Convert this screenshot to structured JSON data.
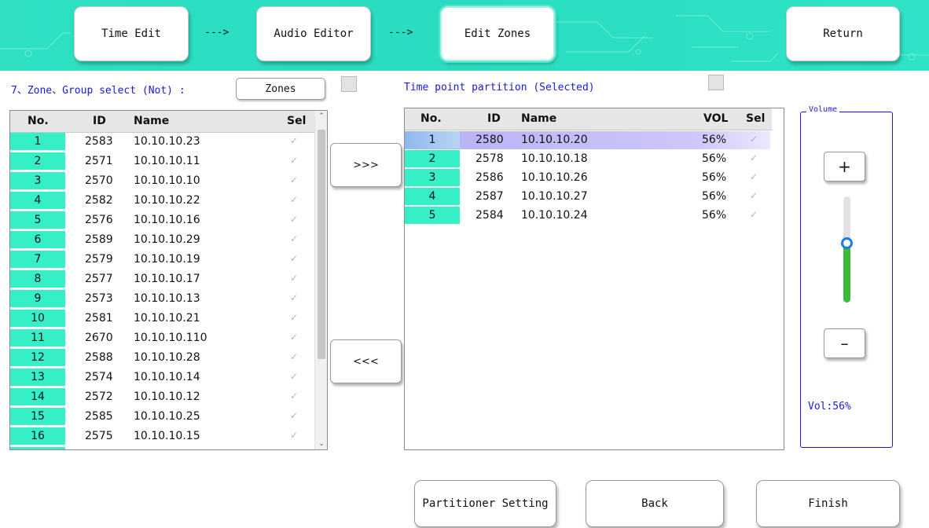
{
  "nav": {
    "steps": [
      {
        "label": "Time Edit"
      },
      {
        "label": "Audio Editor"
      },
      {
        "label": "Edit Zones"
      }
    ],
    "arrow": "--->",
    "return_label": "Return"
  },
  "zone_select": {
    "title": "7、Zone、Group select (Not) :",
    "zones_button": "Zones",
    "headers": {
      "no": "No.",
      "id": "ID",
      "name": "Name",
      "sel": "Sel"
    },
    "rows": [
      {
        "no": "1",
        "id": "2583",
        "name": "10.10.10.23"
      },
      {
        "no": "2",
        "id": "2571",
        "name": "10.10.10.11"
      },
      {
        "no": "3",
        "id": "2570",
        "name": "10.10.10.10"
      },
      {
        "no": "4",
        "id": "2582",
        "name": "10.10.10.22"
      },
      {
        "no": "5",
        "id": "2576",
        "name": "10.10.10.16"
      },
      {
        "no": "6",
        "id": "2589",
        "name": "10.10.10.29"
      },
      {
        "no": "7",
        "id": "2579",
        "name": "10.10.10.19"
      },
      {
        "no": "8",
        "id": "2577",
        "name": "10.10.10.17"
      },
      {
        "no": "9",
        "id": "2573",
        "name": "10.10.10.13"
      },
      {
        "no": "10",
        "id": "2581",
        "name": "10.10.10.21"
      },
      {
        "no": "11",
        "id": "2670",
        "name": "10.10.10.110"
      },
      {
        "no": "12",
        "id": "2588",
        "name": "10.10.10.28"
      },
      {
        "no": "13",
        "id": "2574",
        "name": "10.10.10.14"
      },
      {
        "no": "14",
        "id": "2572",
        "name": "10.10.10.12"
      },
      {
        "no": "15",
        "id": "2585",
        "name": "10.10.10.25"
      },
      {
        "no": "16",
        "id": "2575",
        "name": "10.10.10.15"
      }
    ]
  },
  "move": {
    "add_label": ">>>",
    "remove_label": "<<<"
  },
  "selected_zones": {
    "title": "Time point partition (Selected)",
    "headers": {
      "no": "No.",
      "id": "ID",
      "name": "Name",
      "vol": "VOL",
      "sel": "Sel"
    },
    "rows": [
      {
        "no": "1",
        "id": "2580",
        "name": "10.10.10.20",
        "vol": "56%",
        "highlighted": true
      },
      {
        "no": "2",
        "id": "2578",
        "name": "10.10.10.18",
        "vol": "56%"
      },
      {
        "no": "3",
        "id": "2586",
        "name": "10.10.10.26",
        "vol": "56%"
      },
      {
        "no": "4",
        "id": "2587",
        "name": "10.10.10.27",
        "vol": "56%"
      },
      {
        "no": "5",
        "id": "2584",
        "name": "10.10.10.24",
        "vol": "56%"
      }
    ]
  },
  "volume": {
    "legend": "Volume",
    "plus": "+",
    "minus": "–",
    "level": 0.56,
    "readout": "Vol:56%"
  },
  "footer": {
    "partitioner_label": "Partitioner Setting",
    "back_label": "Back",
    "finish_label": "Finish"
  },
  "colors": {
    "banner": "#2fe0c3",
    "row_number_bg": "#35f0c6",
    "label_blue": "#1a1ad6",
    "selection": "#b6b0f7",
    "slider_fill": "#3cba3a",
    "slider_knob": "#1e7be6"
  }
}
